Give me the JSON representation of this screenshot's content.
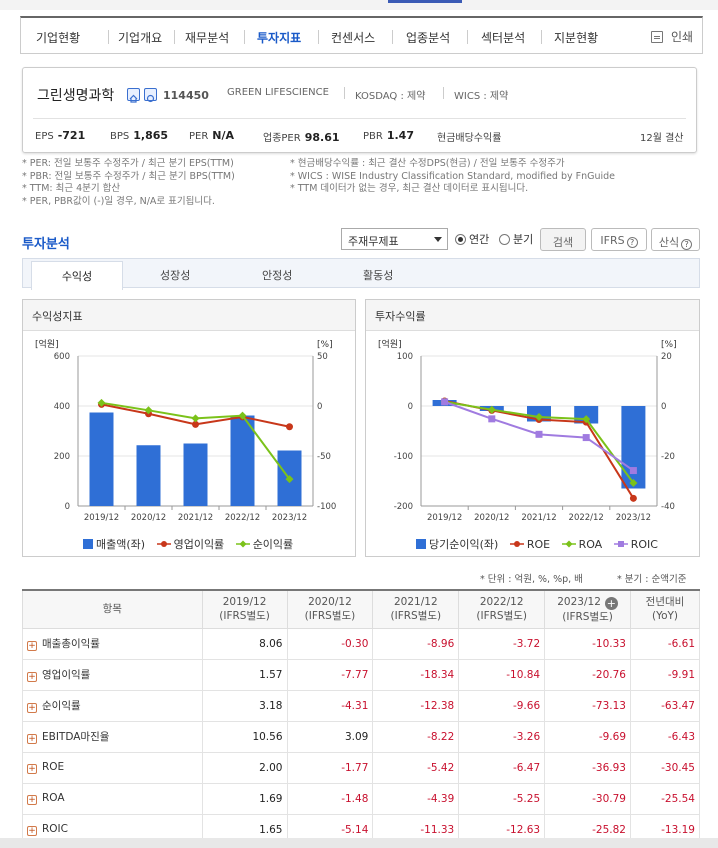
{
  "nav": {
    "items": [
      "기업현황",
      "기업개요",
      "재무분석",
      "투자지표",
      "컨센서스",
      "업종분석",
      "섹터분석",
      "지분현황"
    ],
    "active_index": 3,
    "print_label": "인쇄"
  },
  "company": {
    "name": "그린생명과학",
    "code": "114450",
    "english_name": "GREEN LIFESCIENCE",
    "market": "KOSDAQ : 제약",
    "wics": "WICS : 제약",
    "stats": {
      "eps_label": "EPS",
      "eps": "-721",
      "bps_label": "BPS",
      "bps": "1,865",
      "per_label": "PER",
      "per": "N/A",
      "ind_per_label": "업종PER",
      "ind_per": "98.61",
      "pbr_label": "PBR",
      "pbr": "1.47",
      "dividend_label": "현금배당수익률",
      "fiscal": "12월 결산"
    }
  },
  "notes_left": [
    "* PER: 전일 보통주 수정주가 / 최근 분기 EPS(TTM)",
    "* PBR: 전일 보통주 수정주가 / 최근 분기 BPS(TTM)",
    "* TTM: 최근 4분기 합산",
    "* PER, PBR값이 (-)일 경우, N/A로 표기됩니다."
  ],
  "notes_right": [
    "* 현금배당수익률 : 최근 결산 수정DPS(현금) / 전일 보통주 수정주가",
    "* WICS : WISE Industry Classification Standard, modified by FnGuide",
    "* TTM 데이터가 없는 경우, 최근 결산 데이터로 표시됩니다."
  ],
  "analysis": {
    "title": "투자분석",
    "statement_select": "주재무제표",
    "radio_annual": "연간",
    "radio_quarter": "분기",
    "search_button": "검색",
    "ifrs_button": "IFRS",
    "formula_button": "산식",
    "help_glyph": "?"
  },
  "tabs": [
    "수익성",
    "성장성",
    "안정성",
    "활동성"
  ],
  "chart_data": [
    {
      "type": "bar",
      "title": "수익성지표",
      "categories": [
        "2019/12",
        "2020/12",
        "2021/12",
        "2022/12",
        "2023/12"
      ],
      "left_axis_label": "[억원]",
      "right_axis_label": "[%]",
      "left_ylim": [
        0,
        600
      ],
      "left_ticks": [
        "600",
        "400",
        "200",
        "0"
      ],
      "right_ylim": [
        -100,
        50
      ],
      "right_ticks": [
        "50",
        "0",
        "-50",
        "-100"
      ],
      "series": [
        {
          "name": "매출액(좌)",
          "type": "bar",
          "axis": "left",
          "color": "#2f6fd6",
          "values": [
            374,
            243,
            250,
            362,
            222
          ]
        },
        {
          "name": "영업이익률",
          "type": "line",
          "axis": "right",
          "color": "#c8371a",
          "values": [
            1.57,
            -7.77,
            -18.34,
            -10.84,
            -20.76
          ]
        },
        {
          "name": "순이익률",
          "type": "line",
          "axis": "right",
          "color": "#7bc21a",
          "values": [
            3.18,
            -4.31,
            -12.38,
            -9.66,
            -73.13
          ]
        }
      ],
      "grid": true,
      "legend": "bottom"
    },
    {
      "type": "bar",
      "title": "투자수익률",
      "categories": [
        "2019/12",
        "2020/12",
        "2021/12",
        "2022/12",
        "2023/12"
      ],
      "left_axis_label": "[억원]",
      "right_axis_label": "[%]",
      "left_ylim": [
        -200,
        100
      ],
      "left_ticks": [
        "100",
        "0",
        "-100",
        "-200"
      ],
      "right_ylim": [
        -40,
        20
      ],
      "right_ticks": [
        "20",
        "0",
        "-20",
        "-40"
      ],
      "series": [
        {
          "name": "당기순이익(좌)",
          "type": "bar",
          "axis": "left",
          "color": "#2f6fd6",
          "values": [
            12,
            -10,
            -31,
            -35,
            -165
          ]
        },
        {
          "name": "ROE",
          "type": "line",
          "axis": "right",
          "color": "#c8371a",
          "values": [
            2.0,
            -1.77,
            -5.42,
            -6.47,
            -36.93
          ]
        },
        {
          "name": "ROA",
          "type": "line",
          "axis": "right",
          "color": "#7bc21a",
          "values": [
            1.69,
            -1.48,
            -4.39,
            -5.25,
            -30.79
          ]
        },
        {
          "name": "ROIC",
          "type": "line",
          "axis": "right",
          "color": "#a07be0",
          "values": [
            1.65,
            -5.14,
            -11.33,
            -12.63,
            -25.82
          ]
        }
      ],
      "grid": true,
      "legend": "bottom"
    }
  ],
  "unit_note": "* 단위 : 억원, %, %p, 배",
  "quarter_note": "* 분기 : 순액기준",
  "table": {
    "headers": [
      {
        "l1": "항목",
        "l2": ""
      },
      {
        "l1": "2019/12",
        "l2": "(IFRS별도)"
      },
      {
        "l1": "2020/12",
        "l2": "(IFRS별도)"
      },
      {
        "l1": "2021/12",
        "l2": "(IFRS별도)"
      },
      {
        "l1": "2022/12",
        "l2": "(IFRS별도)"
      },
      {
        "l1": "2023/12",
        "l2": "(IFRS별도)"
      },
      {
        "l1": "전년대비",
        "l2": "(YoY)"
      }
    ],
    "rows": [
      {
        "label": "매출총이익률",
        "values": [
          "8.06",
          "-0.30",
          "-8.96",
          "-3.72",
          "-10.33",
          "-6.61"
        ]
      },
      {
        "label": "영업이익률",
        "values": [
          "1.57",
          "-7.77",
          "-18.34",
          "-10.84",
          "-20.76",
          "-9.91"
        ]
      },
      {
        "label": "순이익률",
        "values": [
          "3.18",
          "-4.31",
          "-12.38",
          "-9.66",
          "-73.13",
          "-63.47"
        ]
      },
      {
        "label": "EBITDA마진율",
        "values": [
          "10.56",
          "3.09",
          "-8.22",
          "-3.26",
          "-9.69",
          "-6.43"
        ]
      },
      {
        "label": "ROE",
        "values": [
          "2.00",
          "-1.77",
          "-5.42",
          "-6.47",
          "-36.93",
          "-30.45"
        ]
      },
      {
        "label": "ROA",
        "values": [
          "1.69",
          "-1.48",
          "-4.39",
          "-5.25",
          "-30.79",
          "-25.54"
        ]
      },
      {
        "label": "ROIC",
        "values": [
          "1.65",
          "-5.14",
          "-11.33",
          "-12.63",
          "-25.82",
          "-13.19"
        ]
      }
    ]
  }
}
